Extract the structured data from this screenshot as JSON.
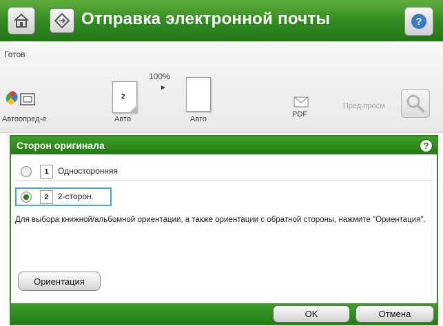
{
  "header": {
    "title": "Отправка электронной почты",
    "home_icon": "home-icon",
    "app_icon": "email-diamond-icon",
    "help_icon": "help-icon"
  },
  "toolbar": {
    "status": "Готов",
    "zoom": "100%",
    "auto_label": "Автоопред-е",
    "sides_label": "Авто",
    "sides_number": "2",
    "page_label": "Авто",
    "format_label": "PDF",
    "preview_label": "Пред.просм"
  },
  "dialog": {
    "title": "Сторон оригинала",
    "options": [
      {
        "number": "1",
        "label": "Односторонняя",
        "selected": false
      },
      {
        "number": "2",
        "label": "2-сторон.",
        "selected": true
      }
    ],
    "description": "Для выбора книжной/альбомной ориентации, а также ориентации с обратной стороны, нажмите \"Ориентация\".",
    "orientation_button": "Ориентация",
    "ok_button": "OK",
    "cancel_button": "Отмена"
  },
  "colors": {
    "header_green": "#2f8a1f",
    "dialog_border": "#2d8a1e",
    "selection_blue": "#4aa3e0"
  }
}
